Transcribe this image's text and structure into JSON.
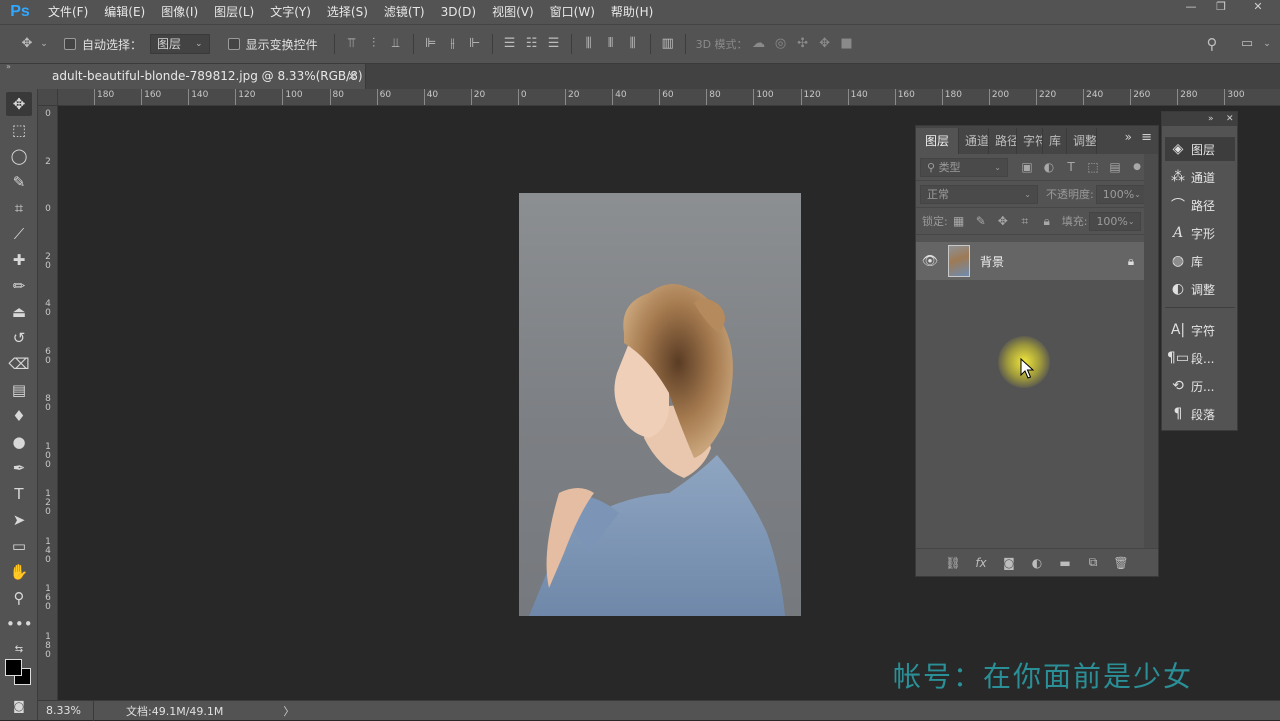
{
  "app": {
    "logo": "Ps"
  },
  "menu": [
    "文件(F)",
    "编辑(E)",
    "图像(I)",
    "图层(L)",
    "文字(Y)",
    "选择(S)",
    "滤镜(T)",
    "3D(D)",
    "视图(V)",
    "窗口(W)",
    "帮助(H)"
  ],
  "window_controls": {
    "minimize": "—",
    "restore": "❐",
    "close": "✕"
  },
  "options": {
    "auto_select_label": "自动选择：",
    "auto_select_value": "图层",
    "show_transform_label": "显示变换控件",
    "mode_3d_label": "3D 模式："
  },
  "document": {
    "tab_title": "adult-beautiful-blonde-789812.jpg @ 8.33%(RGB/8) *",
    "close": "×"
  },
  "rulers": {
    "h_ticks": [
      "180",
      "160",
      "140",
      "120",
      "100",
      "80",
      "60",
      "40",
      "20",
      "0",
      "20",
      "40",
      "60",
      "80",
      "100",
      "120",
      "140",
      "160",
      "180",
      "200",
      "220",
      "240",
      "260",
      "280",
      "300"
    ],
    "v_ticks": [
      "0",
      "2",
      "0",
      "2\n0",
      "4\n0",
      "6\n0",
      "8\n0",
      "1\n0\n0",
      "1\n2\n0",
      "1\n4\n0",
      "1\n6\n0",
      "1\n8\n0"
    ]
  },
  "status": {
    "zoom": "8.33%",
    "doc_size": "文档:49.1M/49.1M",
    "arrow": "〉"
  },
  "layers_panel": {
    "tabs": [
      "图层",
      "通道",
      "路径",
      "字符",
      "库",
      "调整"
    ],
    "filter_placeholder": "类型",
    "blend_mode": "正常",
    "opacity_label": "不透明度:",
    "opacity_value": "100%",
    "lock_label": "锁定:",
    "fill_label": "填充:",
    "fill_value": "100%",
    "layers": [
      {
        "name": "背景",
        "visible": true,
        "locked": true
      }
    ]
  },
  "dock": {
    "items": [
      "图层",
      "通道",
      "路径",
      "字形",
      "库",
      "调整",
      "字符",
      "段...",
      "历...",
      "段落"
    ],
    "active": "图层"
  },
  "watermark": "帐号：在你面前是少女"
}
